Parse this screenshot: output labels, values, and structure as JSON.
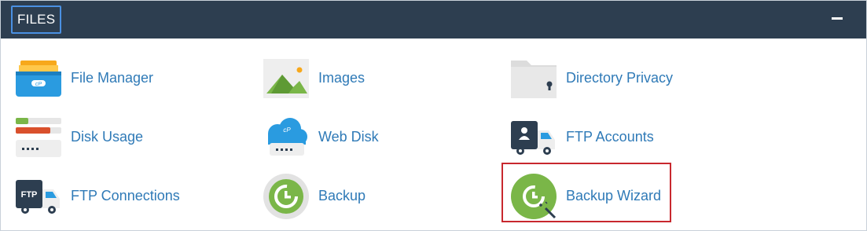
{
  "section": {
    "title": "FILES",
    "collapse_icon": "minus-icon"
  },
  "items": [
    {
      "label": "File Manager",
      "icon": "file-manager-icon"
    },
    {
      "label": "Images",
      "icon": "images-icon"
    },
    {
      "label": "Directory Privacy",
      "icon": "folder-lock-icon"
    },
    {
      "label": "Disk Usage",
      "icon": "disk-usage-icon"
    },
    {
      "label": "Web Disk",
      "icon": "cloud-drive-icon"
    },
    {
      "label": "FTP Accounts",
      "icon": "ftp-truck-user-icon"
    },
    {
      "label": "FTP Connections",
      "icon": "ftp-truck-icon"
    },
    {
      "label": "Backup",
      "icon": "backup-clock-icon"
    },
    {
      "label": "Backup Wizard",
      "icon": "backup-wizard-icon"
    }
  ],
  "colors": {
    "header_bg": "#2d3e50",
    "link": "#2f7ab7",
    "highlight_border": "#c8282e",
    "green": "#7ab648",
    "blue": "#2a9be0",
    "dark": "#2d3e50"
  }
}
